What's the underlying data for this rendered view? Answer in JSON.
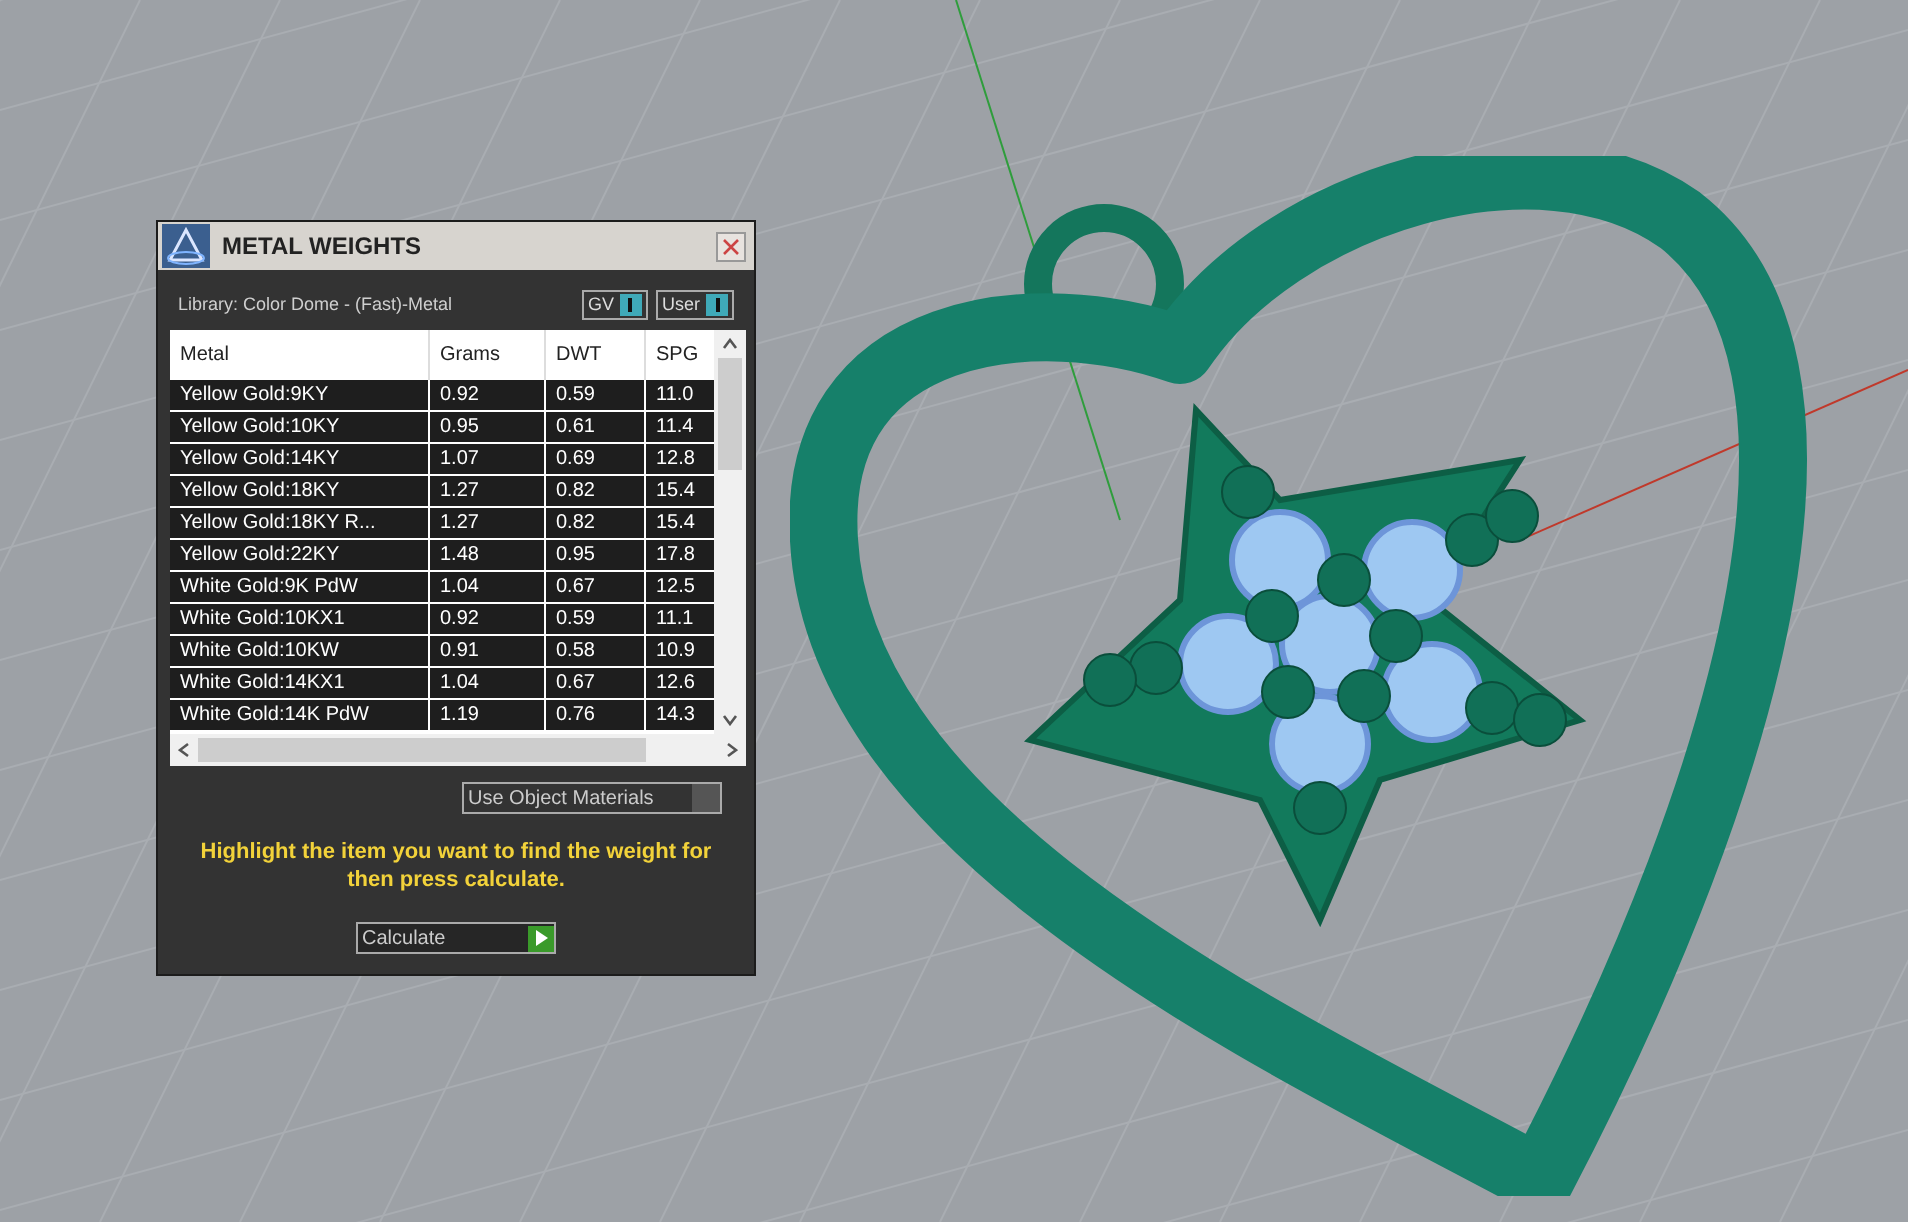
{
  "window": {
    "title": "METAL WEIGHTS"
  },
  "library": {
    "label": "Library: Color Dome - (Fast)-Metal"
  },
  "toggles": [
    {
      "label": "GV",
      "on": true
    },
    {
      "label": "User",
      "on": true
    }
  ],
  "table": {
    "columns": [
      "Metal",
      "Grams",
      "DWT",
      "SPG"
    ],
    "rows": [
      {
        "cells": [
          "Yellow Gold:9KY",
          "0.92",
          "0.59",
          "11.0"
        ],
        "selected": false
      },
      {
        "cells": [
          "Yellow Gold:10KY",
          "0.95",
          "0.61",
          "11.4"
        ],
        "selected": false
      },
      {
        "cells": [
          "Yellow Gold:14KY",
          "1.07",
          "0.69",
          "12.8"
        ],
        "selected": false
      },
      {
        "cells": [
          "Yellow Gold:18KY",
          "1.27",
          "0.82",
          "15.4"
        ],
        "selected": false
      },
      {
        "cells": [
          "Yellow Gold:18KY R...",
          "1.27",
          "0.82",
          "15.4"
        ],
        "selected": false
      },
      {
        "cells": [
          "Yellow Gold:22KY",
          "1.48",
          "0.95",
          "17.8"
        ],
        "selected": false
      },
      {
        "cells": [
          "White Gold:9K PdW",
          "1.04",
          "0.67",
          "12.5"
        ],
        "selected": false
      },
      {
        "cells": [
          "White Gold:10KX1",
          "0.92",
          "0.59",
          "11.1"
        ],
        "selected": false
      },
      {
        "cells": [
          "White Gold:10KW",
          "0.91",
          "0.58",
          "10.9"
        ],
        "selected": false
      },
      {
        "cells": [
          "White Gold:14KX1",
          "1.04",
          "0.67",
          "12.6"
        ],
        "selected": false
      },
      {
        "cells": [
          "White Gold:14K PdW",
          "1.19",
          "0.76",
          "14.3"
        ],
        "selected": false
      }
    ]
  },
  "use_object_materials": {
    "label": "Use Object Materials",
    "checked": false
  },
  "hint": "Highlight the item you want to find the weight for then press calculate.",
  "calculate_button": {
    "label": "Calculate"
  }
}
